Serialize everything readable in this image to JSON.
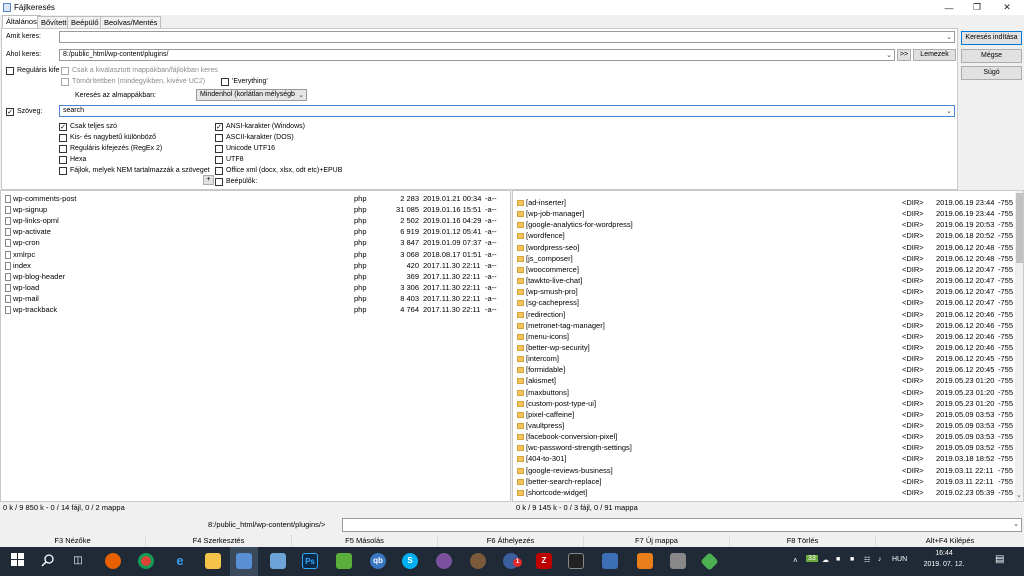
{
  "window": {
    "title": "Fájlkeresés"
  },
  "tabs": [
    {
      "label": "Általános"
    },
    {
      "label": "Bővített"
    },
    {
      "label": "Beépülő"
    },
    {
      "label": "Beolvas/Mentés"
    }
  ],
  "form": {
    "search_for_label": "Amit keres:",
    "search_for_value": "",
    "search_in_label": "Ahol keres:",
    "search_in_value": "8:/public_html/wp-content/plugins/",
    "browse_btn": ">>",
    "drives_btn": "Lemezek",
    "regex_label": "Reguláris kife",
    "only_selected_label": "Csak a kiválasztott mappákban/fájlokban keres",
    "compressed_label": "Tömörítettben (mindegyikben, kivéve UC2)",
    "everything_label": "'Everything'",
    "subdirs_label": "Keresés az almappákban:",
    "subdirs_value": "Mindenhol (korlátlan mélységb",
    "text_label": "Szöveg:",
    "text_value": "search"
  },
  "text_options_left": [
    {
      "label": "Csak teljes szó",
      "checked": true
    },
    {
      "label": "Kis- és nagybetű különböző",
      "checked": false
    },
    {
      "label": "Reguláris kifejezés (RegEx 2)",
      "checked": false
    },
    {
      "label": "Hexa",
      "checked": false
    },
    {
      "label": "Fájlok, melyek NEM tartalmazzák a szöveget",
      "checked": false
    }
  ],
  "text_options_right": [
    {
      "label": "ANSI-karakter (Windows)",
      "checked": true
    },
    {
      "label": "ASCII-karakter (DOS)",
      "checked": false
    },
    {
      "label": "Unicode UTF16",
      "checked": false
    },
    {
      "label": "UTF8",
      "checked": false
    },
    {
      "label": "Office xml (docx, xlsx, odt etc)+EPUB",
      "checked": false
    },
    {
      "label": "Beépülők:",
      "checked": false
    }
  ],
  "plus_btn": "+",
  "right_buttons": {
    "start": "Keresés indítása",
    "cancel": "Mégse",
    "help": "Súgó"
  },
  "left_files": [
    {
      "name": "wp-comments-post",
      "ext": "php",
      "size": "2 283",
      "date": "2019.01.21 00:34",
      "attr": "-a--"
    },
    {
      "name": "wp-signup",
      "ext": "php",
      "size": "31 085",
      "date": "2019.01.16 15:51",
      "attr": "-a--"
    },
    {
      "name": "wp-links-opml",
      "ext": "php",
      "size": "2 502",
      "date": "2019.01.16 04:29",
      "attr": "-a--"
    },
    {
      "name": "wp-activate",
      "ext": "php",
      "size": "6 919",
      "date": "2019.01.12 05:41",
      "attr": "-a--"
    },
    {
      "name": "wp-cron",
      "ext": "php",
      "size": "3 847",
      "date": "2019.01.09 07:37",
      "attr": "-a--"
    },
    {
      "name": "xmlrpc",
      "ext": "php",
      "size": "3 068",
      "date": "2018.08.17 01:51",
      "attr": "-a--"
    },
    {
      "name": "index",
      "ext": "php",
      "size": "420",
      "date": "2017.11.30 22:11",
      "attr": "-a--"
    },
    {
      "name": "wp-blog-header",
      "ext": "php",
      "size": "369",
      "date": "2017.11.30 22:11",
      "attr": "-a--"
    },
    {
      "name": "wp-load",
      "ext": "php",
      "size": "3 306",
      "date": "2017.11.30 22:11",
      "attr": "-a--"
    },
    {
      "name": "wp-mail",
      "ext": "php",
      "size": "8 403",
      "date": "2017.11.30 22:11",
      "attr": "-a--"
    },
    {
      "name": "wp-trackback",
      "ext": "php",
      "size": "4 764",
      "date": "2017.11.30 22:11",
      "attr": "-a--"
    }
  ],
  "right_dirs": [
    {
      "name": "[ad-inserter]",
      "type": "<DIR>",
      "date": "2019.06.19 23:44",
      "attr": "-755"
    },
    {
      "name": "[wp-job-manager]",
      "type": "<DIR>",
      "date": "2019.06.19 23:44",
      "attr": "-755"
    },
    {
      "name": "[google-analytics-for-wordpress]",
      "type": "<DIR>",
      "date": "2019.06.19 20:53",
      "attr": "-755"
    },
    {
      "name": "[wordfence]",
      "type": "<DIR>",
      "date": "2019.06.18 20:52",
      "attr": "-755"
    },
    {
      "name": "[wordpress-seo]",
      "type": "<DIR>",
      "date": "2019.06.12 20:48",
      "attr": "-755"
    },
    {
      "name": "[js_composer]",
      "type": "<DIR>",
      "date": "2019.06.12 20:48",
      "attr": "-755"
    },
    {
      "name": "[woocommerce]",
      "type": "<DIR>",
      "date": "2019.06.12 20:47",
      "attr": "-755"
    },
    {
      "name": "[tawkto-live-chat]",
      "type": "<DIR>",
      "date": "2019.06.12 20:47",
      "attr": "-755"
    },
    {
      "name": "[wp-smush-pro]",
      "type": "<DIR>",
      "date": "2019.06.12 20:47",
      "attr": "-755"
    },
    {
      "name": "[sg-cachepress]",
      "type": "<DIR>",
      "date": "2019.06.12 20:47",
      "attr": "-755"
    },
    {
      "name": "[redirection]",
      "type": "<DIR>",
      "date": "2019.06.12 20:46",
      "attr": "-755"
    },
    {
      "name": "[metronet-tag-manager]",
      "type": "<DIR>",
      "date": "2019.06.12 20:46",
      "attr": "-755"
    },
    {
      "name": "[menu-icons]",
      "type": "<DIR>",
      "date": "2019.06.12 20:46",
      "attr": "-755"
    },
    {
      "name": "[better-wp-security]",
      "type": "<DIR>",
      "date": "2019.06.12 20:46",
      "attr": "-755"
    },
    {
      "name": "[intercom]",
      "type": "<DIR>",
      "date": "2019.06.12 20:45",
      "attr": "-755"
    },
    {
      "name": "[formidable]",
      "type": "<DIR>",
      "date": "2019.06.12 20:45",
      "attr": "-755"
    },
    {
      "name": "[akismet]",
      "type": "<DIR>",
      "date": "2019.05.23 01:20",
      "attr": "-755"
    },
    {
      "name": "[maxbuttons]",
      "type": "<DIR>",
      "date": "2019.05.23 01:20",
      "attr": "-755"
    },
    {
      "name": "[custom-post-type-ui]",
      "type": "<DIR>",
      "date": "2019.05.23 01:20",
      "attr": "-755"
    },
    {
      "name": "[pixel-caffeine]",
      "type": "<DIR>",
      "date": "2019.05.09 03:53",
      "attr": "-755"
    },
    {
      "name": "[vaultpress]",
      "type": "<DIR>",
      "date": "2019.05.09 03:53",
      "attr": "-755"
    },
    {
      "name": "[facebook-conversion-pixel]",
      "type": "<DIR>",
      "date": "2019.05.09 03:53",
      "attr": "-755"
    },
    {
      "name": "[wc-password-strength-settings]",
      "type": "<DIR>",
      "date": "2019.05.09 03:52",
      "attr": "-755"
    },
    {
      "name": "[404-to-301]",
      "type": "<DIR>",
      "date": "2019.03.18 18:52",
      "attr": "-755"
    },
    {
      "name": "[google-reviews-business]",
      "type": "<DIR>",
      "date": "2019.03.11 22:11",
      "attr": "-755"
    },
    {
      "name": "[better-search-replace]",
      "type": "<DIR>",
      "date": "2019.03.11 22:11",
      "attr": "-755"
    },
    {
      "name": "[shortcode-widget]",
      "type": "<DIR>",
      "date": "2019.02.23 05:39",
      "attr": "-755"
    }
  ],
  "status": {
    "left": "0 k / 9 850 k - 0 / 14 fájl, 0 / 2 mappa",
    "right": "0 k / 9 145 k - 0 / 3 fájl, 0 / 91 mappa"
  },
  "cmdline": {
    "path": "8:/public_html/wp-content/plugins/>",
    "value": ""
  },
  "fkeys": [
    "F3 Nézőke",
    "F4 Szerkesztés",
    "F5 Másolás",
    "F6 Áthelyezés",
    "F7 Új mappa",
    "F8 Törlés",
    "Alt+F4 Kilépés"
  ],
  "taskbar": {
    "lang": "HUN",
    "time": "16:44",
    "date": "2019. 07. 12.",
    "badge": "33",
    "mail_badge": "1",
    "icons": [
      "windows-icon",
      "search-icon",
      "task-view-icon",
      "firefox-icon",
      "chrome-icon",
      "edge-icon",
      "file-explorer-icon",
      "save-disk-icon",
      "notepad-icon",
      "photoshop-icon",
      "paint-icon",
      "qbittorrent-icon",
      "skype-icon",
      "viber-icon",
      "teamviewer-icon",
      "mail-icon",
      "filezilla-icon",
      "terminal-icon",
      "network-icon",
      "ccleaner-icon",
      "vpn-icon"
    ]
  },
  "colors": {
    "accent": "#0078d7",
    "taskbar": "#1f2a36",
    "folder": "#f2c55c"
  }
}
